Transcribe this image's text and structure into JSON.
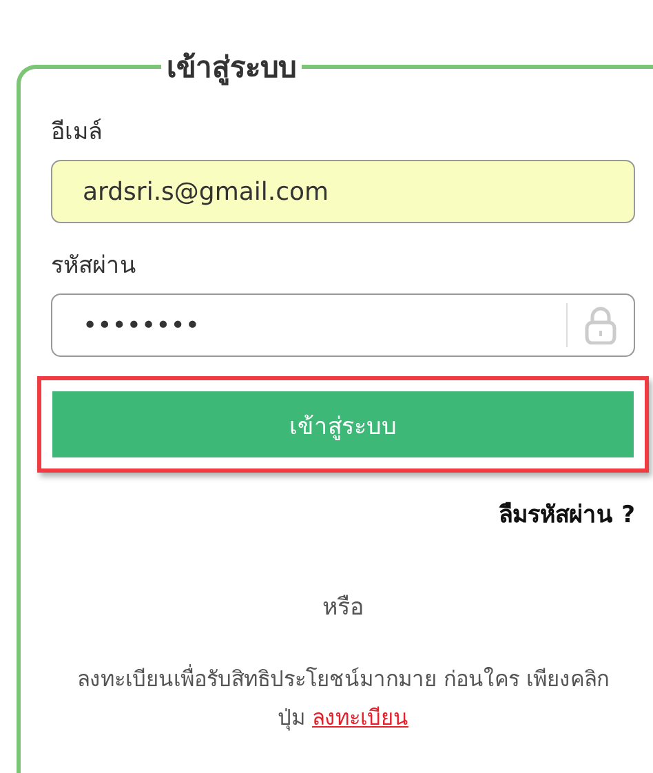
{
  "panel": {
    "title": "เข้าสู่ระบบ"
  },
  "fields": [
    {
      "label": "อีเมล์",
      "value": "ardsri.s@gmail.com",
      "kind": "text",
      "autofilled": true
    },
    {
      "label": "รหัสผ่าน",
      "value": "••••••••",
      "kind": "password",
      "autofilled": false
    }
  ],
  "login_button": {
    "label": "เข้าสู่ระบบ",
    "highlighted": true
  },
  "forgot_link": "ลืมรหัสผ่าน ?",
  "separator": "หรือ",
  "register": {
    "text": "ลงทะเบียนเพื่อรับสิทธิประโยชน์มากมาย ก่อนใคร เพียงคลิกปุ่ม ",
    "link": "ลงทะเบียน"
  }
}
